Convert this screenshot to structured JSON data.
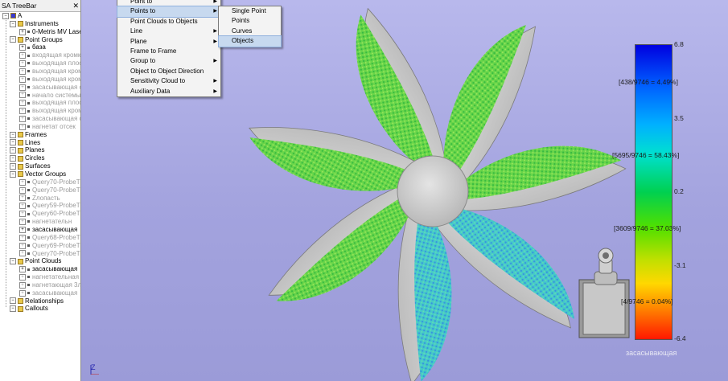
{
  "treebar": {
    "title": "SA TreeBar",
    "close": "✕",
    "items": [
      {
        "label": "A",
        "kind": "root",
        "grey": false
      },
      {
        "label": "Instruments",
        "kind": "folder",
        "grey": false
      },
      {
        "label": "0-Metris MV Lase",
        "kind": "child",
        "grey": false
      },
      {
        "label": "Point Groups",
        "kind": "folder",
        "grey": false
      },
      {
        "label": "база",
        "kind": "child",
        "grey": false
      },
      {
        "label": "входящая кромк",
        "kind": "child",
        "grey": true
      },
      {
        "label": "выходящая плос",
        "kind": "child",
        "grey": true
      },
      {
        "label": "выходящая кром",
        "kind": "child",
        "grey": true
      },
      {
        "label": "выходящая кром",
        "kind": "child",
        "grey": true
      },
      {
        "label": "засасывающая с",
        "kind": "child",
        "grey": true
      },
      {
        "label": "начало системы",
        "kind": "child",
        "grey": true
      },
      {
        "label": "выходящая плос",
        "kind": "child",
        "grey": true
      },
      {
        "label": "выходящая кром",
        "kind": "child",
        "grey": true
      },
      {
        "label": "засасывающая с",
        "kind": "child",
        "grey": true
      },
      {
        "label": "нагнетат отсек",
        "kind": "child",
        "grey": true
      },
      {
        "label": "Frames",
        "kind": "folder",
        "grey": false
      },
      {
        "label": "Lines",
        "kind": "folder",
        "grey": false
      },
      {
        "label": "Planes",
        "kind": "folder",
        "grey": false
      },
      {
        "label": "Circles",
        "kind": "folder",
        "grey": false
      },
      {
        "label": "Surfaces",
        "kind": "folder",
        "grey": false
      },
      {
        "label": "Vector Groups",
        "kind": "folder",
        "grey": false
      },
      {
        "label": "Query70-ProbeT",
        "kind": "child",
        "grey": true
      },
      {
        "label": "Query70-ProbeT",
        "kind": "child",
        "grey": true
      },
      {
        "label": "Zлопасть",
        "kind": "child",
        "grey": true
      },
      {
        "label": "Query59-ProbeT",
        "kind": "child",
        "grey": true
      },
      {
        "label": "Query60-ProbeT",
        "kind": "child",
        "grey": true
      },
      {
        "label": "нагнетательн",
        "kind": "child",
        "grey": true
      },
      {
        "label": "засасывающая",
        "kind": "child",
        "grey": false
      },
      {
        "label": "Query68-ProbeT",
        "kind": "child",
        "grey": true
      },
      {
        "label": "Query69-ProbeT",
        "kind": "child",
        "grey": true
      },
      {
        "label": "Query70-ProbeT",
        "kind": "child",
        "grey": true
      },
      {
        "label": "Point Clouds",
        "kind": "folder",
        "grey": false
      },
      {
        "label": "засасывающая",
        "kind": "child",
        "grey": false
      },
      {
        "label": "нагнетательная",
        "kind": "child",
        "grey": true
      },
      {
        "label": "нагнетающая 3л",
        "kind": "child",
        "grey": true
      },
      {
        "label": "засасывающая",
        "kind": "child",
        "grey": true
      },
      {
        "label": "Relationships",
        "kind": "folder",
        "grey": false
      },
      {
        "label": "Callouts",
        "kind": "folder",
        "grey": false
      }
    ]
  },
  "menu_main": {
    "items": [
      {
        "label": "Point to",
        "submenu": true,
        "highlighted": false
      },
      {
        "label": "Points to",
        "submenu": true,
        "highlighted": true
      },
      {
        "label": "Point Clouds to Objects",
        "submenu": false,
        "highlighted": false
      },
      {
        "label": "Line",
        "submenu": true,
        "highlighted": false
      },
      {
        "label": "Plane",
        "submenu": true,
        "highlighted": false
      },
      {
        "label": "Frame to Frame",
        "submenu": false,
        "highlighted": false
      },
      {
        "label": "Group to",
        "submenu": true,
        "highlighted": false
      },
      {
        "label": "Object to Object Direction",
        "submenu": false,
        "highlighted": false
      },
      {
        "label": "Sensitivity Cloud to",
        "submenu": true,
        "highlighted": false
      },
      {
        "label": "Auxiliary Data",
        "submenu": true,
        "highlighted": false
      }
    ]
  },
  "menu_sub": {
    "items": [
      {
        "label": "Single Point",
        "highlighted": false
      },
      {
        "label": "Points",
        "highlighted": false
      },
      {
        "label": "Curves",
        "highlighted": false
      },
      {
        "label": "Objects",
        "highlighted": true
      }
    ]
  },
  "scale": {
    "values": [
      "6.8",
      "3.5",
      "0.2",
      "-3.1",
      "-6.4"
    ],
    "percentages": [
      "[438/9746 = 4.49%]",
      "[5695/9746 = 58.43%]",
      "[3609/9746 = 37.03%]",
      "[4/9746 = 0.04%]"
    ],
    "name": "засасывающая",
    "colors": {
      "max": "#0000e0",
      "mid": "#00d050",
      "min": "#ff1800"
    }
  },
  "axis": {
    "label": "Z"
  },
  "viewport": {
    "background": "#a3a3de"
  }
}
